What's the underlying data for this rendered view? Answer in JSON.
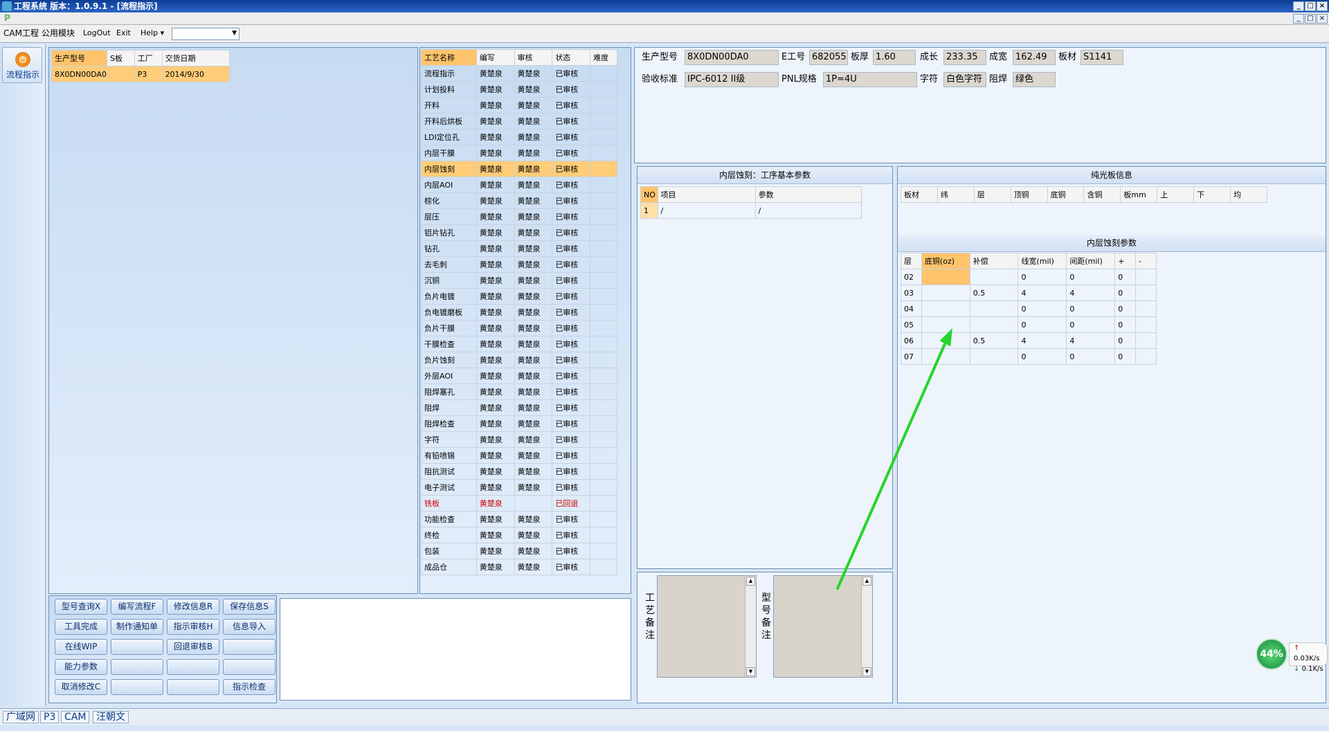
{
  "window": {
    "title": "工程系统    版本：1.0.9.1 - [流程指示]",
    "controls": [
      "_",
      "□",
      "×"
    ]
  },
  "menu": {
    "items": [
      "CAM工程",
      "公用模块",
      "LogOut",
      "Exit",
      "Help ▾"
    ],
    "combo_value": ""
  },
  "nav": {
    "button_label": "流程指示"
  },
  "orders": {
    "columns": [
      "生产型号",
      "S板",
      "工厂",
      "交货日期"
    ],
    "rows": [
      [
        "8X0DN00DA0",
        "",
        "P3",
        "2014/9/30"
      ]
    ]
  },
  "process": {
    "columns": [
      "工艺名称",
      "编写",
      "审核",
      "状态",
      "难度"
    ],
    "rows": [
      [
        "流程指示",
        "黄楚泉",
        "黄楚泉",
        "已审核",
        ""
      ],
      [
        "计划投料",
        "黄楚泉",
        "黄楚泉",
        "已审核",
        ""
      ],
      [
        "开料",
        "黄楚泉",
        "黄楚泉",
        "已审核",
        ""
      ],
      [
        "开料后烘板",
        "黄楚泉",
        "黄楚泉",
        "已审核",
        ""
      ],
      [
        "LDI定位孔",
        "黄楚泉",
        "黄楚泉",
        "已审核",
        ""
      ],
      [
        "内层干膜",
        "黄楚泉",
        "黄楚泉",
        "已审核",
        ""
      ],
      [
        "内层蚀刻",
        "黄楚泉",
        "黄楚泉",
        "已审核",
        ""
      ],
      [
        "内层AOI",
        "黄楚泉",
        "黄楚泉",
        "已审核",
        ""
      ],
      [
        "棕化",
        "黄楚泉",
        "黄楚泉",
        "已审核",
        ""
      ],
      [
        "层压",
        "黄楚泉",
        "黄楚泉",
        "已审核",
        ""
      ],
      [
        "铝片钻孔",
        "黄楚泉",
        "黄楚泉",
        "已审核",
        ""
      ],
      [
        "钻孔",
        "黄楚泉",
        "黄楚泉",
        "已审核",
        ""
      ],
      [
        "去毛刺",
        "黄楚泉",
        "黄楚泉",
        "已审核",
        ""
      ],
      [
        "沉铜",
        "黄楚泉",
        "黄楚泉",
        "已审核",
        ""
      ],
      [
        "负片电镀",
        "黄楚泉",
        "黄楚泉",
        "已审核",
        ""
      ],
      [
        "负电镀磨板",
        "黄楚泉",
        "黄楚泉",
        "已审核",
        ""
      ],
      [
        "负片干膜",
        "黄楚泉",
        "黄楚泉",
        "已审核",
        ""
      ],
      [
        "干膜检查",
        "黄楚泉",
        "黄楚泉",
        "已审核",
        ""
      ],
      [
        "负片蚀刻",
        "黄楚泉",
        "黄楚泉",
        "已审核",
        ""
      ],
      [
        "外层AOI",
        "黄楚泉",
        "黄楚泉",
        "已审核",
        ""
      ],
      [
        "阻焊塞孔",
        "黄楚泉",
        "黄楚泉",
        "已审核",
        ""
      ],
      [
        "阻焊",
        "黄楚泉",
        "黄楚泉",
        "已审核",
        ""
      ],
      [
        "阻焊检查",
        "黄楚泉",
        "黄楚泉",
        "已审核",
        ""
      ],
      [
        "字符",
        "黄楚泉",
        "黄楚泉",
        "已审核",
        ""
      ],
      [
        "有铅喷锡",
        "黄楚泉",
        "黄楚泉",
        "已审核",
        ""
      ],
      [
        "阻抗测试",
        "黄楚泉",
        "黄楚泉",
        "已审核",
        ""
      ],
      [
        "电子测试",
        "黄楚泉",
        "黄楚泉",
        "已审核",
        ""
      ],
      [
        "铣板",
        "黄楚泉",
        "",
        "已回退",
        ""
      ],
      [
        "功能检查",
        "黄楚泉",
        "黄楚泉",
        "已审核",
        ""
      ],
      [
        "终检",
        "黄楚泉",
        "黄楚泉",
        "已审核",
        ""
      ],
      [
        "包装",
        "黄楚泉",
        "黄楚泉",
        "已审核",
        ""
      ],
      [
        "成品仓",
        "黄楚泉",
        "黄楚泉",
        "已审核",
        ""
      ]
    ],
    "selected_row": 6,
    "returned_row": 27
  },
  "info": {
    "fields": [
      {
        "label": "生产型号",
        "value": "8X0DN00DA0"
      },
      {
        "label": "E工号",
        "value": "682055"
      },
      {
        "label": "板厚",
        "value": "1.60"
      },
      {
        "label": "成长",
        "value": "233.35"
      },
      {
        "label": "成宽",
        "value": "162.49"
      },
      {
        "label": "板材",
        "value": "S1141"
      },
      {
        "label": "验收标准",
        "value": "IPC-6012 II级"
      },
      {
        "label": "PNL规格",
        "value": "1P=4U"
      },
      {
        "label": "字符",
        "value": "白色字符"
      },
      {
        "label": "阻焊",
        "value": "绿色"
      }
    ]
  },
  "basic_params": {
    "caption": "内层蚀刻：工序基本参数",
    "columns": [
      "NO",
      "项目",
      "参数"
    ],
    "rows": [
      [
        "1",
        "/",
        "/"
      ]
    ]
  },
  "plain_board": {
    "caption": "纯光板信息",
    "columns": [
      "板材",
      "纬",
      "层",
      "顶铜",
      "底铜",
      "含铜",
      "板mm",
      "上",
      "下",
      "均"
    ]
  },
  "etch_params": {
    "caption": "内层蚀刻参数",
    "columns": [
      "层",
      "底铜(oz)",
      "补偿",
      "线宽(mil)",
      "间距(mil)",
      "+",
      "-"
    ],
    "rows": [
      [
        "02",
        "",
        "",
        "0",
        "0",
        "0",
        ""
      ],
      [
        "03",
        "",
        "0.5",
        "4",
        "4",
        "0",
        ""
      ],
      [
        "04",
        "",
        "",
        "0",
        "0",
        "0",
        ""
      ],
      [
        "05",
        "",
        "",
        "0",
        "0",
        "0",
        ""
      ],
      [
        "06",
        "",
        "0.5",
        "4",
        "4",
        "0",
        ""
      ],
      [
        "07",
        "",
        "",
        "0",
        "0",
        "0",
        ""
      ]
    ]
  },
  "buttons": [
    [
      "型号查询X",
      "编写流程F",
      "修改信息R",
      "保存信息S"
    ],
    [
      "工具完成",
      "制作通知单",
      "指示审核H",
      "信息导入"
    ],
    [
      "在线WIP",
      "",
      "回退审核B",
      ""
    ],
    [
      "能力参数",
      "",
      "",
      ""
    ],
    [
      "取消修改C",
      "",
      "",
      "指示检查"
    ]
  ],
  "notes": {
    "craft_label": "工艺备注",
    "model_label": "型号备注"
  },
  "status": {
    "items": [
      "广域网",
      "P3",
      "CAM",
      "汪朝文"
    ]
  },
  "net": {
    "percent": "44%",
    "up": "0.03K/s",
    "down": "0.1K/s"
  },
  "colors": {
    "selected_row": "#ffcc78",
    "title_bar": "#1a4fa8",
    "panel": "#d6e6f6",
    "returned_text": "#d00000",
    "annotation_arrow": "#27d42a"
  }
}
